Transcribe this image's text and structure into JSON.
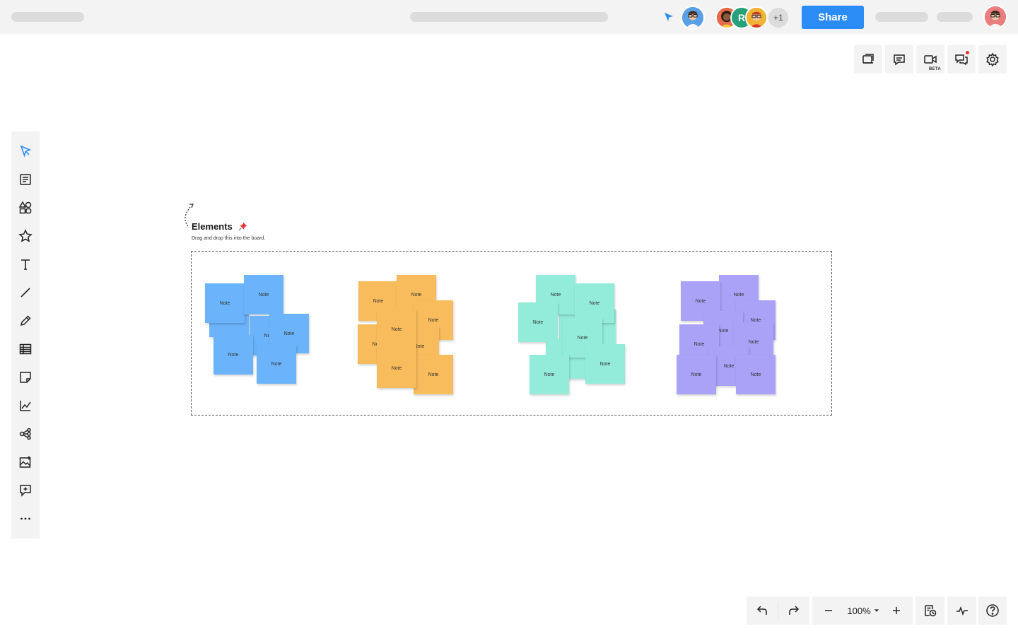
{
  "topbar": {
    "share_label": "Share",
    "extra_collaborators": "+1",
    "collaborator_initial": "R"
  },
  "toolbar_right": {
    "beta_label": "BETA"
  },
  "left_toolbar": {
    "items": [
      "select",
      "text-block",
      "shapes",
      "stickers",
      "text",
      "line",
      "pen",
      "table",
      "sticky-note",
      "chart",
      "mind-map",
      "image",
      "comment",
      "more"
    ]
  },
  "canvas": {
    "frame_title": "Elements",
    "frame_subtitle": "Drag and drop this into the board.",
    "note_label": "Note",
    "note_colors": {
      "blue": "#6bb3fb",
      "orange": "#f8bc5c",
      "teal": "#93ecd9",
      "purple": "#a9a2f7"
    }
  },
  "bottom_bar": {
    "zoom_level": "100%"
  },
  "colors": {
    "accent": "#2b8cf5",
    "toolbar_bg": "#f3f3f3"
  }
}
